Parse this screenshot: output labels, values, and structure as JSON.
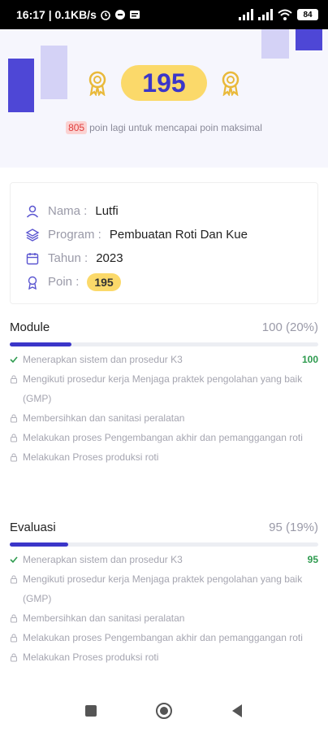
{
  "status_bar": {
    "time_info": "16:17 | 0.1KB/s",
    "battery": "84"
  },
  "hero": {
    "points": "195",
    "remaining_value": "805",
    "remaining_text": "poin lagi untuk mencapai poin maksimal"
  },
  "profile": {
    "name_label": "Nama :",
    "name_value": "Lutfi",
    "program_label": "Program :",
    "program_value": "Pembuatan Roti Dan Kue",
    "year_label": "Tahun :",
    "year_value": "2023",
    "points_label": "Poin :",
    "points_value": "195"
  },
  "module": {
    "title": "Module",
    "score": "100 (20%)",
    "progress": 0.2,
    "items": [
      {
        "text": "Menerapkan sistem dan prosedur K3",
        "score": "100",
        "done": true
      },
      {
        "text": "Mengikuti prosedur kerja Menjaga praktek pengolahan yang baik (GMP)",
        "score": "",
        "done": false
      },
      {
        "text": "Membersihkan dan sanitasi peralatan",
        "score": "",
        "done": false
      },
      {
        "text": "Melakukan proses Pengembangan akhir dan pemanggangan roti",
        "score": "",
        "done": false
      },
      {
        "text": "Melakukan Proses produksi roti",
        "score": "",
        "done": false
      }
    ]
  },
  "evaluasi": {
    "title": "Evaluasi",
    "score": "95 (19%)",
    "progress": 0.19,
    "items": [
      {
        "text": "Menerapkan sistem dan prosedur K3",
        "score": "95",
        "done": true
      },
      {
        "text": "Mengikuti prosedur kerja Menjaga praktek pengolahan yang baik (GMP)",
        "score": "",
        "done": false
      },
      {
        "text": "Membersihkan dan sanitasi peralatan",
        "score": "",
        "done": false
      },
      {
        "text": "Melakukan proses Pengembangan akhir dan pemanggangan roti",
        "score": "",
        "done": false
      },
      {
        "text": "Melakukan Proses produksi roti",
        "score": "",
        "done": false
      }
    ]
  },
  "colors": {
    "primary": "#3b36c9",
    "accent_yellow": "#fbd96a",
    "success": "#2e9b4f",
    "muted_text": "#a5a5b0"
  }
}
